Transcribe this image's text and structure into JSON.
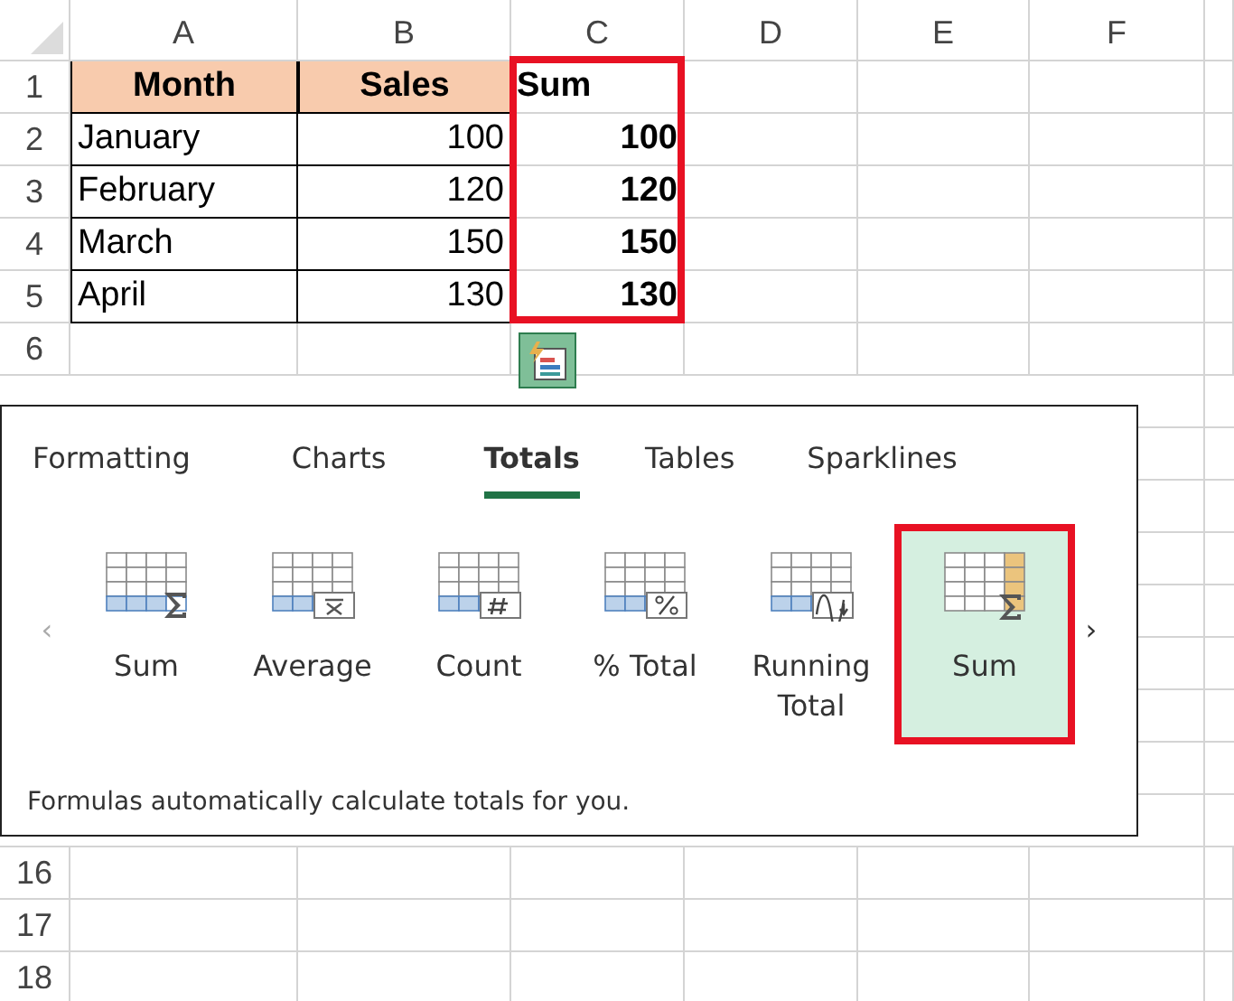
{
  "sheet": {
    "columns": [
      {
        "label": "A",
        "outlined": false
      },
      {
        "label": "B",
        "outlined": false
      },
      {
        "label": "C",
        "outlined": true
      },
      {
        "label": "D",
        "outlined": false
      },
      {
        "label": "E",
        "outlined": false
      },
      {
        "label": "F",
        "outlined": false
      }
    ],
    "rows": [
      {
        "label": "1",
        "cells": [
          {
            "text": "Month",
            "kind": "header"
          },
          {
            "text": "Sales",
            "kind": "header"
          },
          {
            "text": "Sum",
            "kind": "total-head"
          }
        ]
      },
      {
        "label": "2",
        "cells": [
          {
            "text": "January",
            "kind": "label"
          },
          {
            "text": "100",
            "kind": "value"
          },
          {
            "text": "100",
            "kind": "total"
          }
        ]
      },
      {
        "label": "3",
        "cells": [
          {
            "text": "February",
            "kind": "label"
          },
          {
            "text": "120",
            "kind": "value"
          },
          {
            "text": "120",
            "kind": "total"
          }
        ]
      },
      {
        "label": "4",
        "cells": [
          {
            "text": "March",
            "kind": "label"
          },
          {
            "text": "150",
            "kind": "value"
          },
          {
            "text": "150",
            "kind": "total"
          }
        ]
      },
      {
        "label": "5",
        "cells": [
          {
            "text": "April",
            "kind": "label"
          },
          {
            "text": "130",
            "kind": "value"
          },
          {
            "text": "130",
            "kind": "total"
          }
        ]
      },
      {
        "label": "6",
        "cells": []
      }
    ],
    "rows_below": [
      {
        "label": "16"
      },
      {
        "label": "17"
      },
      {
        "label": "18"
      }
    ]
  },
  "quick_analysis": {
    "tabs": [
      {
        "label": "Formatting",
        "selected": false
      },
      {
        "label": "Charts",
        "selected": false
      },
      {
        "label": "Totals",
        "selected": true
      },
      {
        "label": "Tables",
        "selected": false
      },
      {
        "label": "Sparklines",
        "selected": false
      }
    ],
    "prev": "‹",
    "next": "›",
    "items": [
      {
        "label": "Sum",
        "kind": "sum",
        "selected": false,
        "outlined": false
      },
      {
        "label": "Average",
        "kind": "average",
        "selected": false,
        "outlined": false
      },
      {
        "label": "Count",
        "kind": "count",
        "selected": false,
        "outlined": false
      },
      {
        "label": "% Total",
        "kind": "percent",
        "selected": false,
        "outlined": false
      },
      {
        "label": "Running Total",
        "kind": "running",
        "selected": false,
        "outlined": false
      },
      {
        "label": "Sum",
        "kind": "sum-column",
        "selected": true,
        "outlined": true
      }
    ],
    "description": "Formulas automatically calculate totals for you."
  }
}
